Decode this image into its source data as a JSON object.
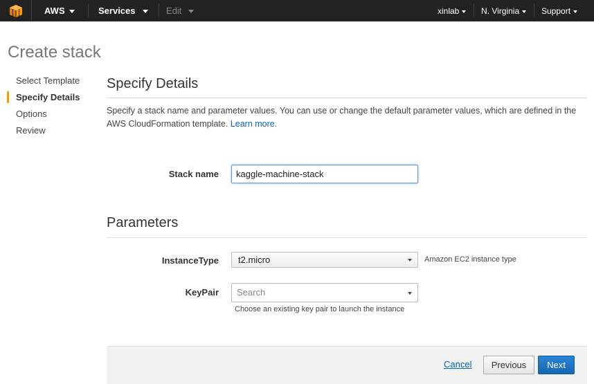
{
  "topbar": {
    "brand": "AWS",
    "services": "Services",
    "edit": "Edit",
    "user": "xinlab",
    "region": "N. Virginia",
    "support": "Support"
  },
  "page_title": "Create stack",
  "steps": [
    {
      "label": "Select Template",
      "active": false
    },
    {
      "label": "Specify Details",
      "active": true
    },
    {
      "label": "Options",
      "active": false
    },
    {
      "label": "Review",
      "active": false
    }
  ],
  "details": {
    "title": "Specify Details",
    "description": "Specify a stack name and parameter values. You can use or change the default parameter values, which are defined in the AWS CloudFormation template.",
    "learn_more": "Learn more.",
    "stack_name_label": "Stack name",
    "stack_name_value": "kaggle-machine-stack"
  },
  "parameters": {
    "title": "Parameters",
    "instance_type_label": "InstanceType",
    "instance_type_value": "t2.micro",
    "instance_type_hint": "Amazon EC2 instance type",
    "keypair_label": "KeyPair",
    "keypair_placeholder": "Search",
    "keypair_hint": "Choose an existing key pair to launch the instance"
  },
  "footer": {
    "cancel": "Cancel",
    "previous": "Previous",
    "next": "Next"
  },
  "colors": {
    "nav_bg": "#222222",
    "accent": "#ff9900",
    "link": "#0066c0",
    "primary_button": "#1a6fbd"
  }
}
